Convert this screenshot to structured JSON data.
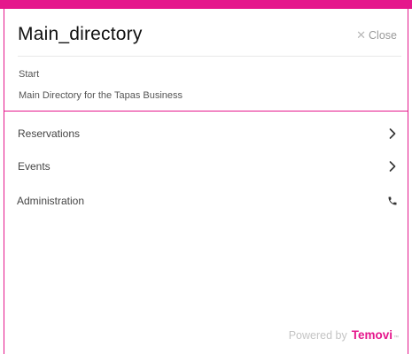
{
  "header": {
    "title": "Main_directory",
    "close_label": "Close"
  },
  "breadcrumb": "Start",
  "description": "Main Directory for the Tapas Business",
  "menu": {
    "items": [
      {
        "label": "Reservations",
        "icon": "chevron-right-icon"
      },
      {
        "label": "Events",
        "icon": "chevron-right-icon"
      },
      {
        "label": "Administration",
        "icon": "phone-icon"
      }
    ]
  },
  "footer": {
    "powered_by": "Powered by",
    "brand": "Temovi",
    "trademark": "™"
  },
  "colors": {
    "accent": "#e5178c",
    "text": "#444444",
    "muted": "#9a9a9a"
  }
}
